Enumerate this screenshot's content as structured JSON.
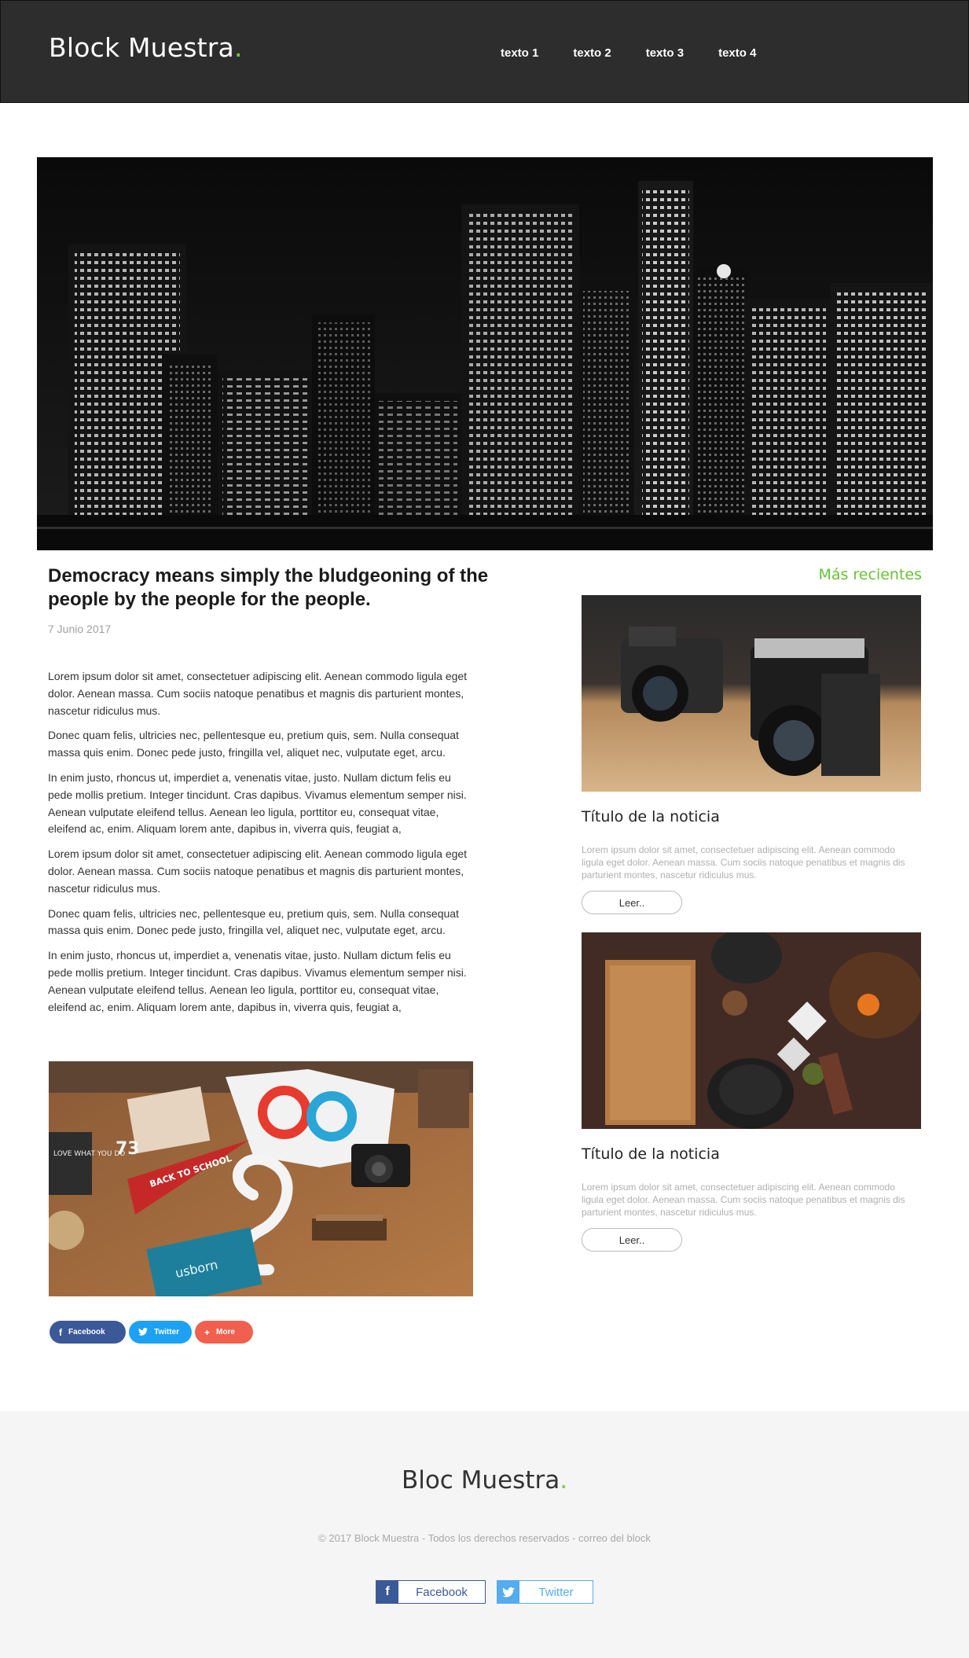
{
  "header": {
    "logo": "Block Muestra",
    "logo_dot": ".",
    "nav": [
      "texto 1",
      "texto 2",
      "texto 3",
      "texto 4"
    ]
  },
  "article": {
    "title": "Democracy means simply the bludgeoning of the people by the people for the people.",
    "date": "7 Junio 2017",
    "paragraphs": [
      "Lorem ipsum dolor sit amet, consectetuer adipiscing elit. Aenean commodo ligula eget dolor. Aenean massa. Cum sociis natoque penatibus et magnis dis parturient montes, nascetur ridiculus mus.",
      "Donec quam felis, ultricies nec, pellentesque eu, pretium quis, sem. Nulla consequat massa quis enim. Donec pede justo, fringilla vel, aliquet nec, vulputate eget, arcu.",
      "In enim justo, rhoncus ut, imperdiet a, venenatis vitae, justo. Nullam dictum felis eu pede mollis pretium. Integer tincidunt. Cras dapibus. Vivamus elementum semper nisi. Aenean vulputate eleifend tellus. Aenean leo ligula, porttitor eu, consequat vitae, eleifend ac, enim. Aliquam lorem ante, dapibus in, viverra quis, feugiat a,",
      "Lorem ipsum dolor sit amet, consectetuer adipiscing elit. Aenean commodo ligula eget dolor. Aenean massa. Cum sociis natoque penatibus et magnis dis parturient montes, nascetur ridiculus mus.",
      "Donec quam felis, ultricies nec, pellentesque eu, pretium quis, sem. Nulla consequat massa quis enim. Donec pede justo, fringilla vel, aliquet nec, vulputate eget, arcu.",
      "In enim justo, rhoncus ut, imperdiet a, venenatis vitae, justo. Nullam dictum felis eu pede mollis pretium. Integer tincidunt. Cras dapibus. Vivamus elementum semper nisi. Aenean vulputate eleifend tellus. Aenean leo ligula, porttitor eu, consequat vitae, eleifend ac, enim. Aliquam lorem ante, dapibus in, viverra quis, feugiat a,"
    ],
    "image_text": {
      "pennant": "BACK TO SCHOOL",
      "notebook": "usborn",
      "poster": "LOVE WHAT YOU DO",
      "number": "73"
    },
    "share": {
      "facebook": "Facebook",
      "twitter": "Twitter",
      "more": "More"
    }
  },
  "sidebar": {
    "heading": "Más recientes",
    "cards": [
      {
        "title": "Título de la noticia",
        "text": "Lorem ipsum dolor sit amet, consectetuer adipiscing elit. Aenean commodo ligula eget dolor. Aenean massa. Cum sociis natoque penatibus et magnis dis parturient montes, nascetur ridiculus mus.",
        "button": "Leer.."
      },
      {
        "title": "Título de la noticia",
        "text": "Lorem ipsum dolor sit amet, consectetuer adipiscing elit. Aenean commodo ligula eget dolor. Aenean massa. Cum sociis natoque penatibus et magnis dis parturient montes, nascetur ridiculus mus.",
        "button": "Leer.."
      }
    ]
  },
  "footer": {
    "logo": "Bloc Muestra",
    "logo_dot": ".",
    "copyright": "© 2017 Block Muestra - Todos los derechos reservados - correo del block",
    "facebook": "Facebook",
    "twitter": "Twitter"
  },
  "colors": {
    "accent_green": "#7ac943",
    "header_bg": "#2d2d2d",
    "facebook": "#3b5998",
    "twitter": "#1da1f2",
    "more": "#f1604f"
  }
}
